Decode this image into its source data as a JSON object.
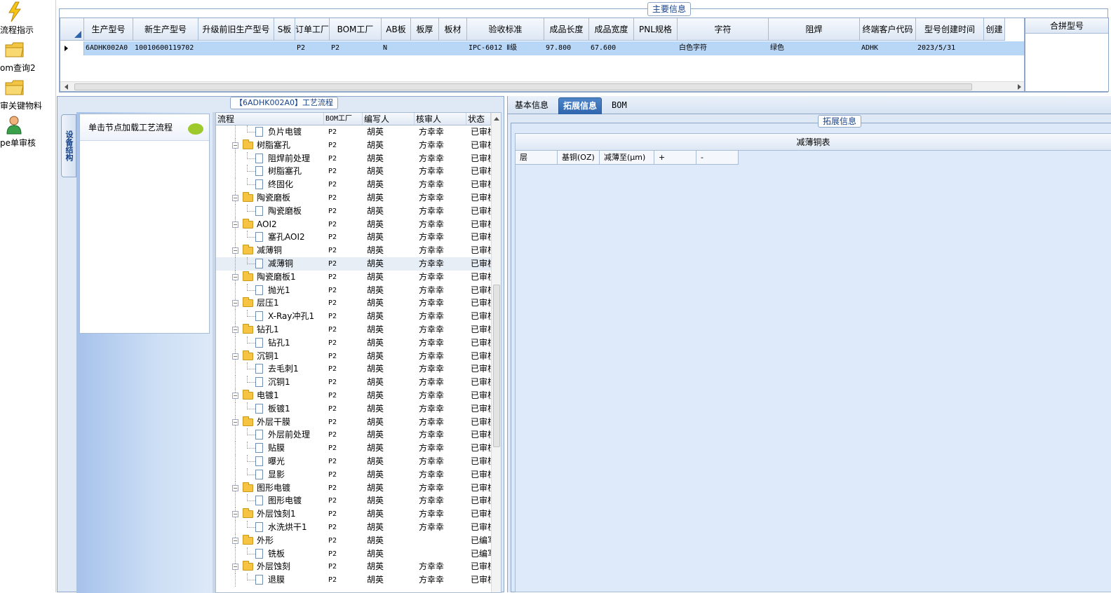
{
  "sidebar": {
    "items": [
      {
        "label": "流程指示",
        "icon": "lightning-icon"
      },
      {
        "label": "om查询2",
        "icon": "folder-icon"
      },
      {
        "label": "审关键物料",
        "icon": "folder-icon"
      },
      {
        "label": "pe单审核",
        "icon": "user-icon"
      }
    ]
  },
  "main_info": {
    "title": "主要信息",
    "columns": [
      "生产型号",
      "新生产型号",
      "升级前旧生产型号",
      "S板",
      "订单工厂",
      "BOM工厂",
      "AB板",
      "板厚",
      "板材",
      "验收标准",
      "成品长度",
      "成品宽度",
      "PNL规格",
      "字符",
      "阻焊",
      "终端客户代码",
      "型号创建时间",
      "创建"
    ],
    "row": [
      "6ADHK002A0",
      "10010600119702",
      "",
      "",
      "P2",
      "P2",
      "N",
      "",
      "",
      "IPC-6012 Ⅱ级",
      "97.800",
      "67.600",
      "",
      "白色字符",
      "绿色",
      "ADHK",
      "2023/5/31",
      ""
    ],
    "merge_header": "合拼型号"
  },
  "flow": {
    "title": "【6ADHK002A0】工艺流程",
    "vertical_tab": "设备结构",
    "load_hint": "单击节点加载工艺流程",
    "columns": [
      "流程",
      "BOM工厂",
      "编写人",
      "核审人",
      "状态"
    ],
    "rows": [
      {
        "level": 1,
        "name": "负片电镀",
        "bom": "P2",
        "writer": "胡英",
        "reviewer": "方幸幸",
        "status": "已审核"
      },
      {
        "level": 0,
        "name": "树脂塞孔",
        "bom": "P2",
        "writer": "胡英",
        "reviewer": "方幸幸",
        "status": "已审核"
      },
      {
        "level": 1,
        "name": "阻焊前处理",
        "bom": "P2",
        "writer": "胡英",
        "reviewer": "方幸幸",
        "status": "已审核"
      },
      {
        "level": 1,
        "name": "树脂塞孔",
        "bom": "P2",
        "writer": "胡英",
        "reviewer": "方幸幸",
        "status": "已审核"
      },
      {
        "level": 1,
        "name": "终固化",
        "bom": "P2",
        "writer": "胡英",
        "reviewer": "方幸幸",
        "status": "已审核"
      },
      {
        "level": 0,
        "name": "陶瓷磨板",
        "bom": "P2",
        "writer": "胡英",
        "reviewer": "方幸幸",
        "status": "已审核"
      },
      {
        "level": 1,
        "name": "陶瓷磨板",
        "bom": "P2",
        "writer": "胡英",
        "reviewer": "方幸幸",
        "status": "已审核"
      },
      {
        "level": 0,
        "name": "AOI2",
        "bom": "P2",
        "writer": "胡英",
        "reviewer": "方幸幸",
        "status": "已审核"
      },
      {
        "level": 1,
        "name": "塞孔AOI2",
        "bom": "P2",
        "writer": "胡英",
        "reviewer": "方幸幸",
        "status": "已审核"
      },
      {
        "level": 0,
        "name": "减薄铜",
        "bom": "P2",
        "writer": "胡英",
        "reviewer": "方幸幸",
        "status": "已审核"
      },
      {
        "level": 1,
        "name": "减薄铜",
        "bom": "P2",
        "writer": "胡英",
        "reviewer": "方幸幸",
        "status": "已审核",
        "selected": true
      },
      {
        "level": 0,
        "name": "陶瓷磨板1",
        "bom": "P2",
        "writer": "胡英",
        "reviewer": "方幸幸",
        "status": "已审核"
      },
      {
        "level": 1,
        "name": "抛光1",
        "bom": "P2",
        "writer": "胡英",
        "reviewer": "方幸幸",
        "status": "已审核"
      },
      {
        "level": 0,
        "name": "层压1",
        "bom": "P2",
        "writer": "胡英",
        "reviewer": "方幸幸",
        "status": "已审核"
      },
      {
        "level": 1,
        "name": "X-Ray冲孔1",
        "bom": "P2",
        "writer": "胡英",
        "reviewer": "方幸幸",
        "status": "已审核"
      },
      {
        "level": 0,
        "name": "钻孔1",
        "bom": "P2",
        "writer": "胡英",
        "reviewer": "方幸幸",
        "status": "已审核"
      },
      {
        "level": 1,
        "name": "钻孔1",
        "bom": "P2",
        "writer": "胡英",
        "reviewer": "方幸幸",
        "status": "已审核"
      },
      {
        "level": 0,
        "name": "沉铜1",
        "bom": "P2",
        "writer": "胡英",
        "reviewer": "方幸幸",
        "status": "已审核"
      },
      {
        "level": 1,
        "name": "去毛刺1",
        "bom": "P2",
        "writer": "胡英",
        "reviewer": "方幸幸",
        "status": "已审核"
      },
      {
        "level": 1,
        "name": "沉铜1",
        "bom": "P2",
        "writer": "胡英",
        "reviewer": "方幸幸",
        "status": "已审核"
      },
      {
        "level": 0,
        "name": "电镀1",
        "bom": "P2",
        "writer": "胡英",
        "reviewer": "方幸幸",
        "status": "已审核"
      },
      {
        "level": 1,
        "name": "板镀1",
        "bom": "P2",
        "writer": "胡英",
        "reviewer": "方幸幸",
        "status": "已审核"
      },
      {
        "level": 0,
        "name": "外层干膜",
        "bom": "P2",
        "writer": "胡英",
        "reviewer": "方幸幸",
        "status": "已审核"
      },
      {
        "level": 1,
        "name": "外层前处理",
        "bom": "P2",
        "writer": "胡英",
        "reviewer": "方幸幸",
        "status": "已审核"
      },
      {
        "level": 1,
        "name": "贴膜",
        "bom": "P2",
        "writer": "胡英",
        "reviewer": "方幸幸",
        "status": "已审核"
      },
      {
        "level": 1,
        "name": "曝光",
        "bom": "P2",
        "writer": "胡英",
        "reviewer": "方幸幸",
        "status": "已审核"
      },
      {
        "level": 1,
        "name": "显影",
        "bom": "P2",
        "writer": "胡英",
        "reviewer": "方幸幸",
        "status": "已审核"
      },
      {
        "level": 0,
        "name": "图形电镀",
        "bom": "P2",
        "writer": "胡英",
        "reviewer": "方幸幸",
        "status": "已审核"
      },
      {
        "level": 1,
        "name": "图形电镀",
        "bom": "P2",
        "writer": "胡英",
        "reviewer": "方幸幸",
        "status": "已审核"
      },
      {
        "level": 0,
        "name": "外层蚀刻1",
        "bom": "P2",
        "writer": "胡英",
        "reviewer": "方幸幸",
        "status": "已审核"
      },
      {
        "level": 1,
        "name": "水洗烘干1",
        "bom": "P2",
        "writer": "胡英",
        "reviewer": "方幸幸",
        "status": "已审核"
      },
      {
        "level": 0,
        "name": "外形",
        "bom": "P2",
        "writer": "胡英",
        "reviewer": "",
        "status": "已编写"
      },
      {
        "level": 1,
        "name": "铣板",
        "bom": "P2",
        "writer": "胡英",
        "reviewer": "",
        "status": "已编写"
      },
      {
        "level": 0,
        "name": "外层蚀刻",
        "bom": "P2",
        "writer": "胡英",
        "reviewer": "方幸幸",
        "status": "已审核"
      },
      {
        "level": 1,
        "name": "退膜",
        "bom": "P2",
        "writer": "胡英",
        "reviewer": "方幸幸",
        "status": "已审核"
      }
    ]
  },
  "right": {
    "tabs": [
      {
        "label": "基本信息",
        "active": false
      },
      {
        "label": "拓展信息",
        "active": true
      },
      {
        "label": "BOM",
        "active": false
      }
    ],
    "ext_title": "拓展信息",
    "reduce_table_title": "减薄铜表",
    "reduce_columns": [
      "层",
      "基铜(OZ)",
      "减薄至(μm)",
      "+",
      "-"
    ]
  },
  "colors": {
    "accent": "#2e64ad",
    "selected_row": "#b8d6f6",
    "panel_bg": "#dfe9f6"
  }
}
